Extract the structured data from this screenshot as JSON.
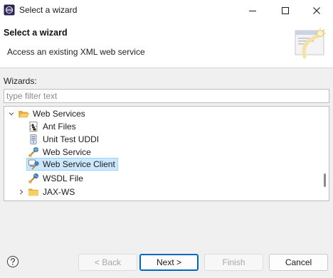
{
  "window": {
    "title": "Select a wizard"
  },
  "banner": {
    "title": "Select a wizard",
    "description": "Access an existing XML web service"
  },
  "wizards_label": "Wizards:",
  "filter": {
    "value": "",
    "placeholder": "type filter text"
  },
  "tree": {
    "items": [
      {
        "label": "Web Services",
        "icon": "folder-open-icon",
        "expanded": true
      },
      {
        "label": "Ant Files",
        "icon": "ant-icon"
      },
      {
        "label": "Unit Test UDDI",
        "icon": "uddi-icon"
      },
      {
        "label": "Web Service",
        "icon": "web-service-icon"
      },
      {
        "label": "Web Service Client",
        "icon": "web-service-client-icon",
        "selected": true
      },
      {
        "label": "WSDL File",
        "icon": "wsdl-icon"
      },
      {
        "label": "JAX-WS",
        "icon": "folder-icon",
        "expanded": false
      }
    ]
  },
  "buttons": {
    "back": "< Back",
    "next": "Next >",
    "finish": "Finish",
    "cancel": "Cancel"
  },
  "colors": {
    "selection_bg": "#cce8ff",
    "selection_border": "#99d1ff",
    "primary_border": "#0067c0"
  }
}
